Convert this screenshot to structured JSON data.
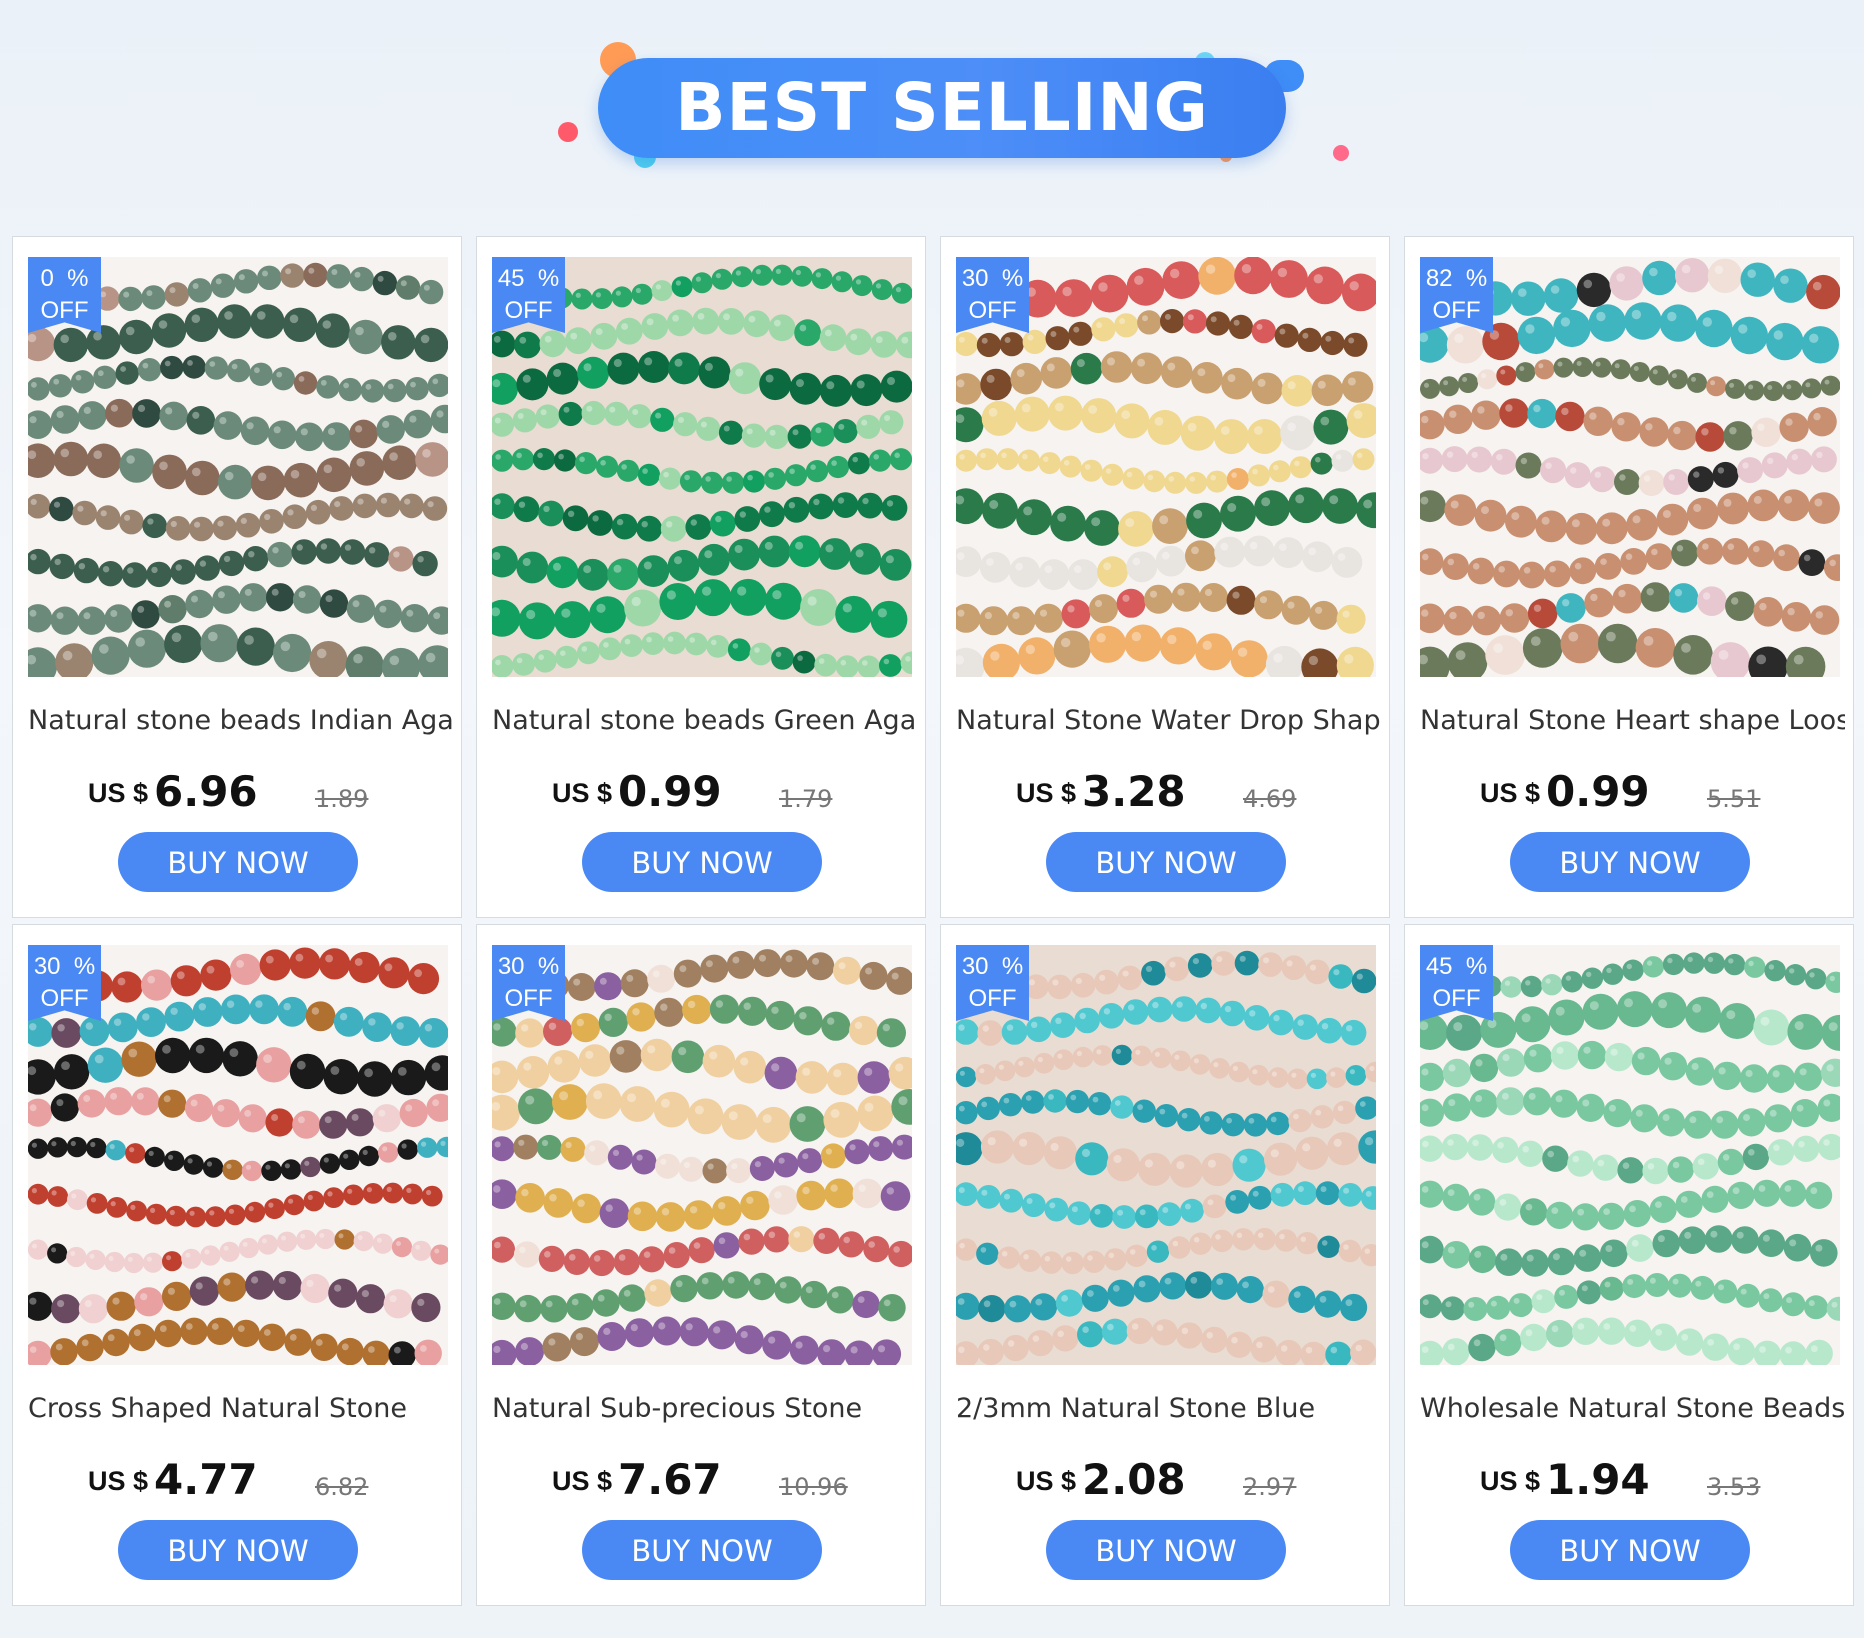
{
  "banner": {
    "title": "BEST SELLING"
  },
  "currency_label": "US $",
  "button_label": "BUY NOW",
  "colors": {
    "accent": "#4a89f3",
    "banner": "#3f8df7"
  },
  "products": [
    {
      "discount": "0  %",
      "off": "OFF",
      "title": "Natural stone beads Indian Agat",
      "price": "6.96",
      "old_price": "1.89",
      "image": "beads-indian-agate"
    },
    {
      "discount": "45  %",
      "off": "OFF",
      "title": "Natural stone beads Green Agat",
      "price": "0.99",
      "old_price": "1.79",
      "image": "beads-green-agate"
    },
    {
      "discount": "30  %",
      "off": "OFF",
      "title": "Natural Stone Water Drop Shape",
      "price": "3.28",
      "old_price": "4.69",
      "image": "beads-water-drop"
    },
    {
      "discount": "82  %",
      "off": "OFF",
      "title": "Natural Stone Heart shape Loose",
      "price": "0.99",
      "old_price": "5.51",
      "image": "beads-heart"
    },
    {
      "discount": "30  %",
      "off": "OFF",
      "title": "Cross Shaped Natural Stone",
      "price": "4.77",
      "old_price": "6.82",
      "image": "beads-cross"
    },
    {
      "discount": "30  %",
      "off": "OFF",
      "title": "Natural Sub-precious Stone",
      "price": "7.67",
      "old_price": "10.96",
      "image": "beads-leaf"
    },
    {
      "discount": "30  %",
      "off": "OFF",
      "title": "2/3mm Natural Stone Blue",
      "price": "2.08",
      "old_price": "2.97",
      "image": "beads-turquoise"
    },
    {
      "discount": "45  %",
      "off": "OFF",
      "title": "Wholesale Natural Stone Beads",
      "price": "1.94",
      "old_price": "3.53",
      "image": "beads-aventurine"
    }
  ]
}
